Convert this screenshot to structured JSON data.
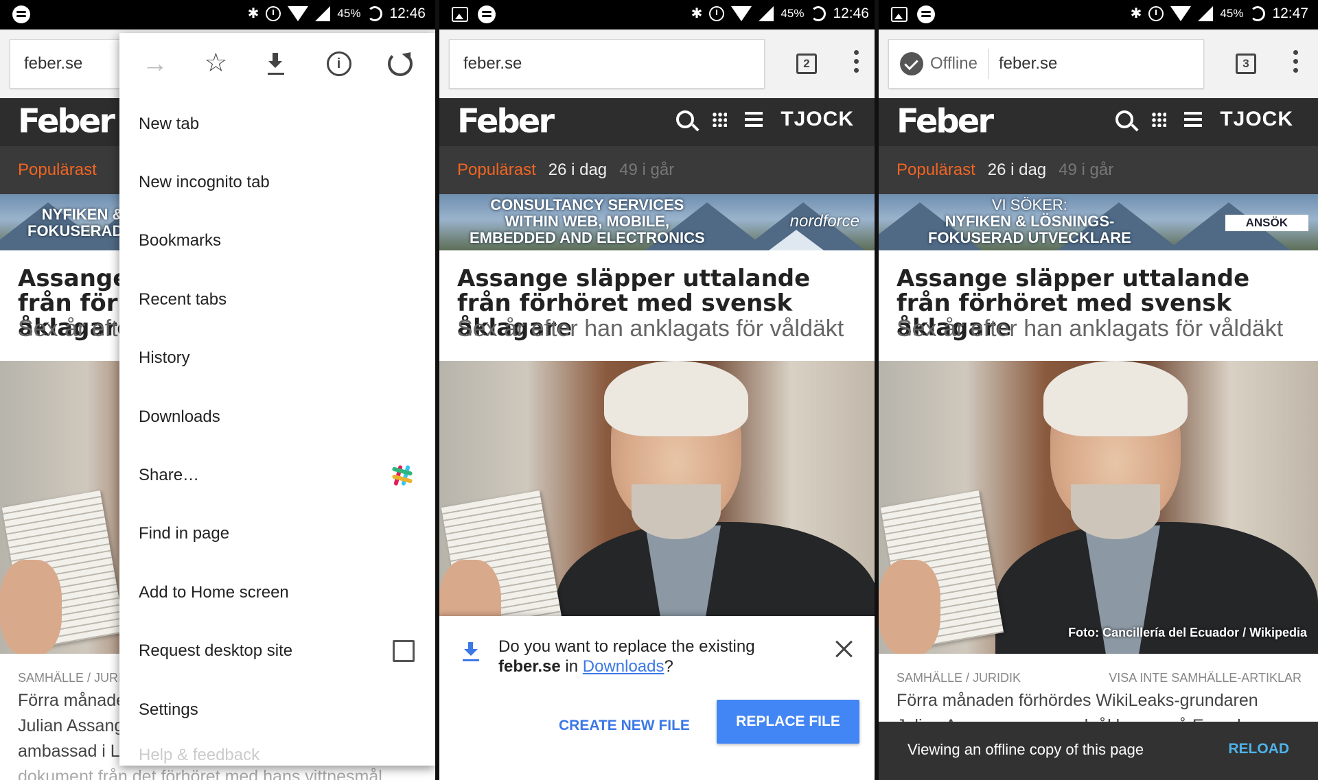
{
  "status_bars": [
    {
      "battery": "45%",
      "time": "12:46"
    },
    {
      "battery": "45%",
      "time": "12:46"
    },
    {
      "battery": "45%",
      "time": "12:47"
    }
  ],
  "toolbar": {
    "url": "feber.se",
    "tab_counts": [
      "2",
      "3"
    ],
    "offline_label": "Offline"
  },
  "site": {
    "logo": "Feber",
    "tjock": "TJOCK",
    "popular_label": "Populärast",
    "today": "26 i dag",
    "yesterday": "49 i går"
  },
  "banners": {
    "one": {
      "line1": "NYFIKEN &",
      "line2": "FOKUSERAD"
    },
    "two": {
      "line1": "CONSULTANCY SERVICES",
      "line2": "WITHIN WEB, MOBILE,",
      "line3": "EMBEDDED AND ELECTRONICS",
      "brand": "nordforce"
    },
    "three": {
      "line0": "VI SÖKER:",
      "line1": "NYFIKEN & LÖSNINGS-",
      "line2": "FOKUSERAD UTVECKLARE",
      "cta": "ANSÖK"
    }
  },
  "article": {
    "title": "Assange släpper uttalande från förhöret med svensk åklagare",
    "subtitle": "Sex år efter han anklagats för våldäkt",
    "photo_credit": "Foto: Cancillería del Ecuador / Wikipedia",
    "category": "SAMHÄLLE / JURIDIK",
    "hide_link": "VISA INTE SAMHÄLLE-ARTIKLAR",
    "teaser_line1": "Förra månaden förhördes WikiLeaks-grundaren",
    "teaser_line2": "Julian Assange av svensk åklagare på Ecuadors",
    "teaser_line3": "ambassad i London. Nu har han publicerat ett",
    "teaser_line4": "dokument från det förhöret med hans vittnesmål."
  },
  "menu": {
    "items": [
      {
        "label": "New tab"
      },
      {
        "label": "New incognito tab"
      },
      {
        "label": "Bookmarks"
      },
      {
        "label": "Recent tabs"
      },
      {
        "label": "History"
      },
      {
        "label": "Downloads"
      },
      {
        "label": "Share…"
      },
      {
        "label": "Find in page"
      },
      {
        "label": "Add to Home screen"
      },
      {
        "label": "Request desktop site"
      },
      {
        "label": "Settings"
      },
      {
        "label": "Help & feedback"
      }
    ]
  },
  "download_dialog": {
    "question": "Do you want to replace the existing",
    "filename": "feber.se",
    "in_word": "in",
    "downloads_link": "Downloads",
    "qmark": "?",
    "create_button": "CREATE NEW FILE",
    "replace_button": "REPLACE FILE"
  },
  "snackbar": {
    "message": "Viewing an offline copy of this page",
    "action": "RELOAD"
  },
  "colors": {
    "accent_orange": "#f26522",
    "chrome_blue": "#4285f4",
    "header_dark": "#2d2d2d",
    "snackbar_bg": "#323232"
  }
}
